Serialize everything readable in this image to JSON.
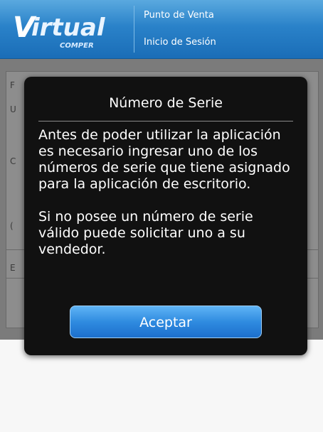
{
  "header": {
    "logo_text": "Virtual",
    "logo_subtext": "COMPER",
    "line1": "Punto de Venta",
    "line2": "Inicio de Sesión",
    "colors": {
      "bar_top": "#5aa9df",
      "bar_bottom": "#1a6db7"
    }
  },
  "background": {
    "partial_chars": [
      "F",
      "U",
      "C",
      "(",
      "E"
    ]
  },
  "dialog": {
    "title": "Número de Serie",
    "paragraph1": "Antes de poder utilizar la aplicación es necesario ingresar uno de los números de serie que tiene asignado para la aplicación de escritorio.",
    "paragraph2": "Si no posee un número de serie válido puede solicitar uno a su vendedor.",
    "button_label": "Aceptar",
    "colors": {
      "background": "#111111",
      "button": "#2f8be0"
    }
  }
}
